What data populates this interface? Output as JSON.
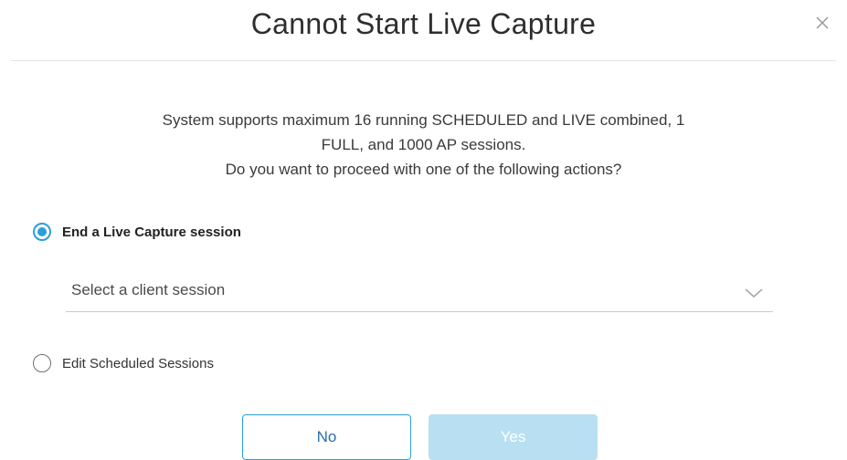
{
  "dialog": {
    "title": "Cannot Start Live Capture",
    "close_icon": "close-icon",
    "message_lines": [
      "System supports maximum 16 running SCHEDULED and LIVE combined, 1",
      "FULL, and 1000 AP sessions.",
      "Do you want to proceed with one of the following actions?"
    ],
    "options": [
      {
        "label": "End a Live Capture session",
        "selected": true
      },
      {
        "label": "Edit Scheduled Sessions",
        "selected": false
      }
    ],
    "client_session_select": {
      "placeholder": "Select a client session",
      "icon": "chevron-down-icon"
    },
    "buttons": {
      "no_label": "No",
      "yes_label": "Yes",
      "yes_disabled": true
    }
  },
  "colors": {
    "accent": "#2aa0d8",
    "disabled_button": "#b8e0f2",
    "divider": "#e2e4e6"
  }
}
